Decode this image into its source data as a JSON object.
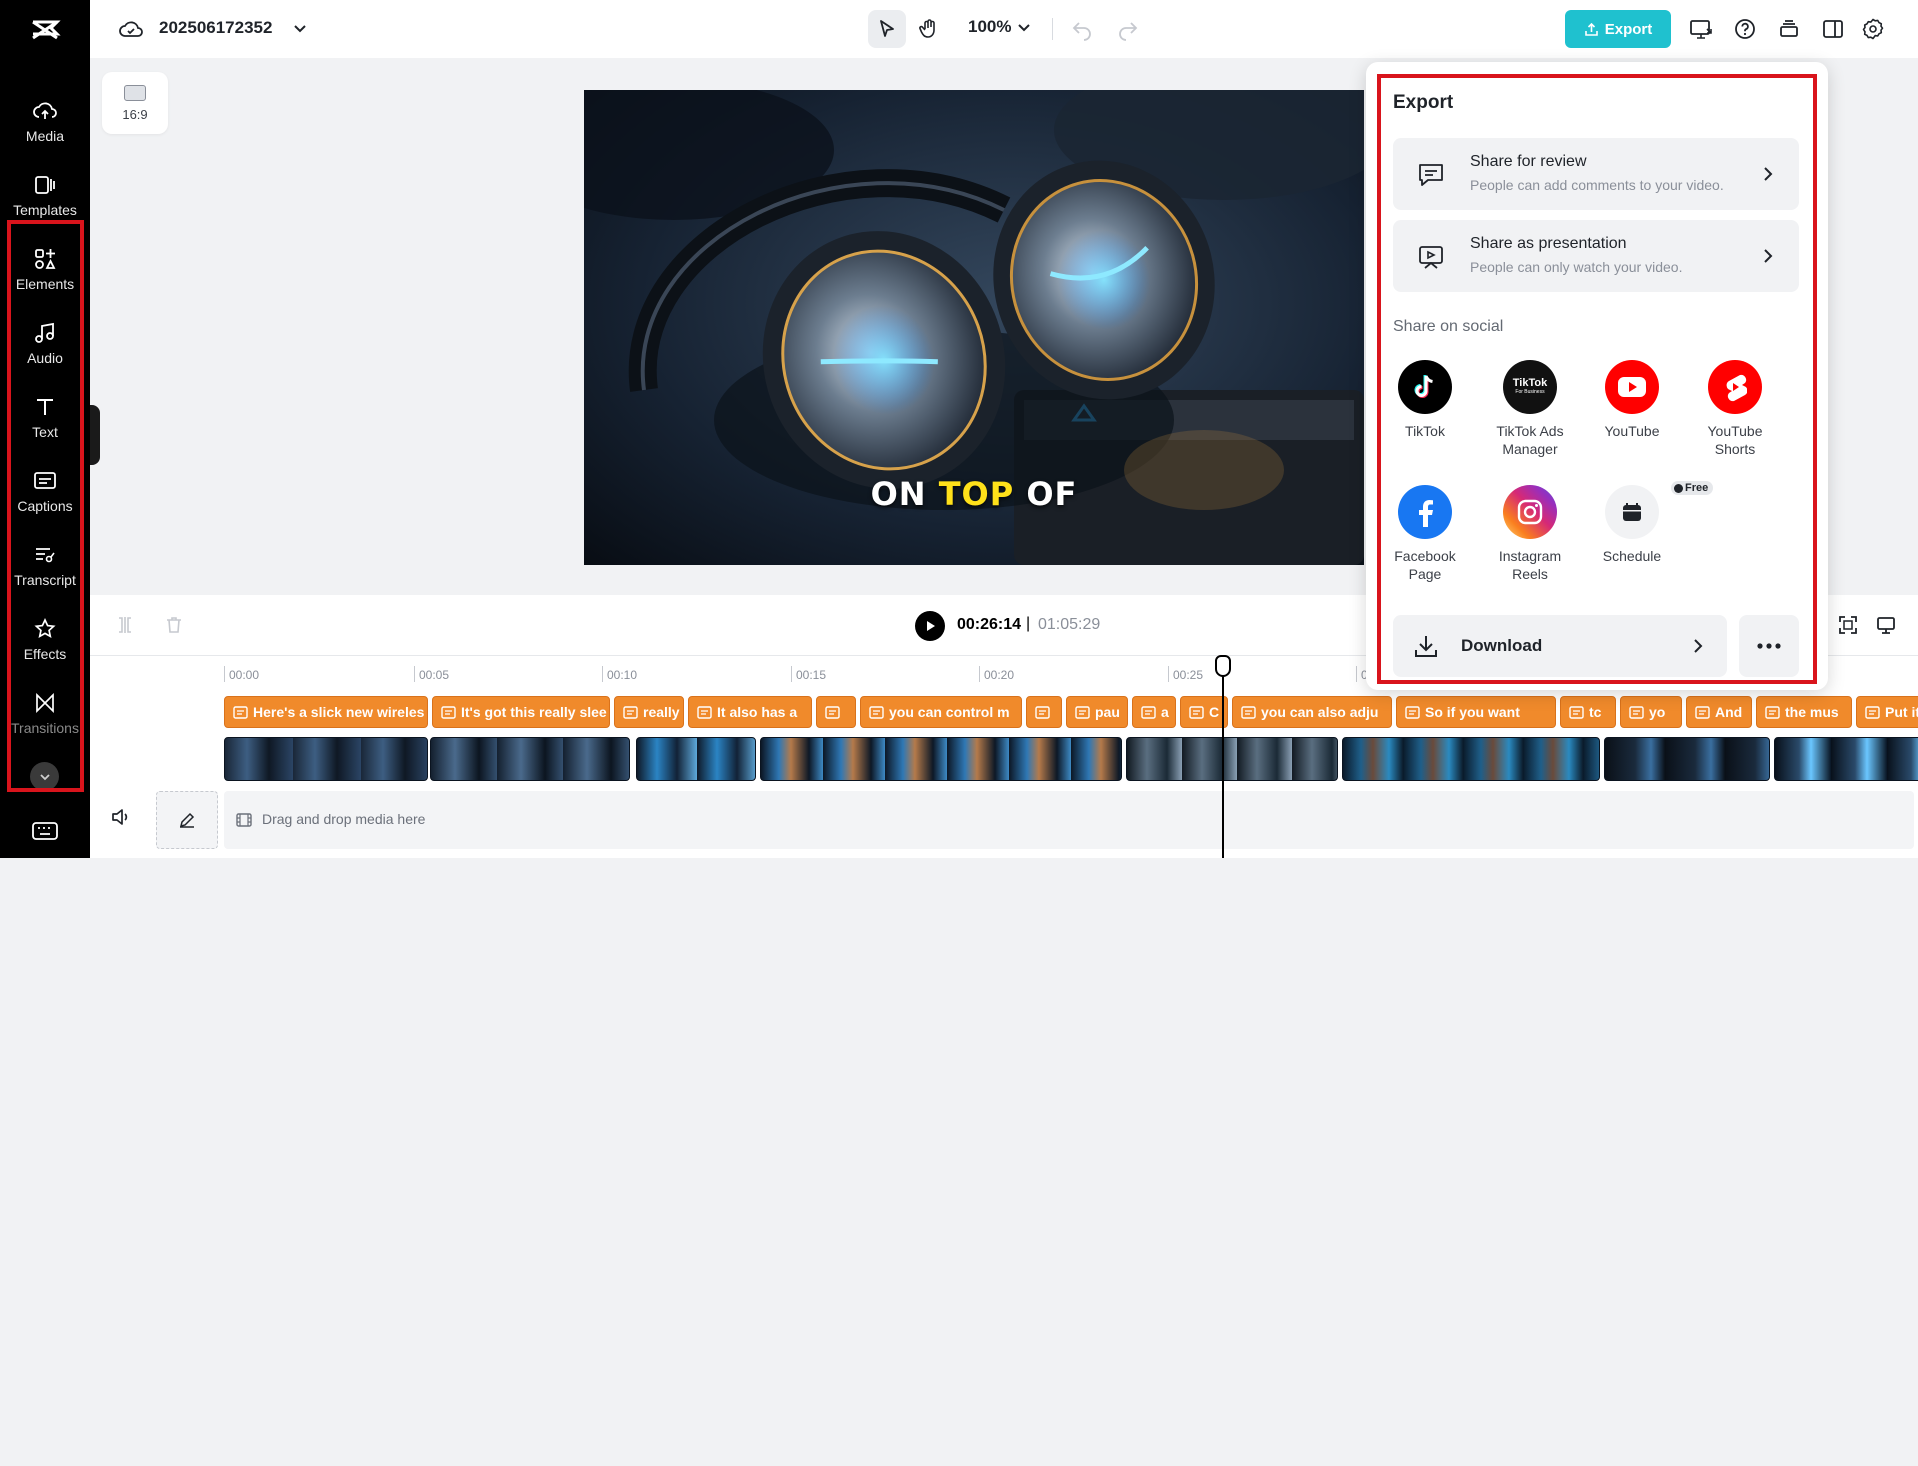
{
  "sidebar": {
    "items": [
      {
        "label": "Media"
      },
      {
        "label": "Templates"
      },
      {
        "label": "Elements"
      },
      {
        "label": "Audio"
      },
      {
        "label": "Text"
      },
      {
        "label": "Captions"
      },
      {
        "label": "Transcript"
      },
      {
        "label": "Effects"
      },
      {
        "label": "Transitions"
      }
    ]
  },
  "header": {
    "project_name": "202506172352",
    "zoom": "100%",
    "export_label": "Export"
  },
  "canvas": {
    "ratio_label": "16:9",
    "caption_words": [
      "ON",
      "TOP",
      "OF"
    ],
    "highlight_color": "#ffe11a"
  },
  "playback": {
    "current_time": "00:26:14",
    "separator": "|",
    "duration": "01:05:29"
  },
  "timeline": {
    "ticks": [
      "00:00",
      "00:05",
      "00:10",
      "00:15",
      "00:20",
      "00:25",
      "0"
    ],
    "captions": [
      "Here's a slick new wireles",
      "It's got this really slee",
      "really",
      "It also has a",
      "",
      "you can control m",
      "",
      "pau",
      "a",
      "C",
      "you can also adju",
      "So if you want",
      "tc",
      "yo",
      "And",
      "the mus",
      "Put it I"
    ],
    "drop_hint": "Drag and drop media here"
  },
  "export_panel": {
    "title": "Export",
    "share_review": {
      "title": "Share for review",
      "subtitle": "People can add comments to your video."
    },
    "share_presentation": {
      "title": "Share as presentation",
      "subtitle": "People can only watch your video."
    },
    "social_label": "Share on social",
    "social": [
      {
        "name": "TikTok",
        "icon": "tiktok-icon"
      },
      {
        "name": "TikTok Ads Manager",
        "icon": "tiktok-business-icon"
      },
      {
        "name": "YouTube",
        "icon": "youtube-icon"
      },
      {
        "name": "YouTube Shorts",
        "icon": "youtube-shorts-icon"
      },
      {
        "name": "Facebook Page",
        "icon": "facebook-icon"
      },
      {
        "name": "Instagram Reels",
        "icon": "instagram-icon"
      },
      {
        "name": "Schedule",
        "icon": "calendar-icon"
      }
    ],
    "tiktok_business_text": "TikTok",
    "tiktok_business_sub": "For Business",
    "free_badge": "Free",
    "download_label": "Download"
  },
  "colors": {
    "accent": "#1fc1cf",
    "caption_clip": "#f08a2b",
    "highlight_border": "#d9141c"
  }
}
